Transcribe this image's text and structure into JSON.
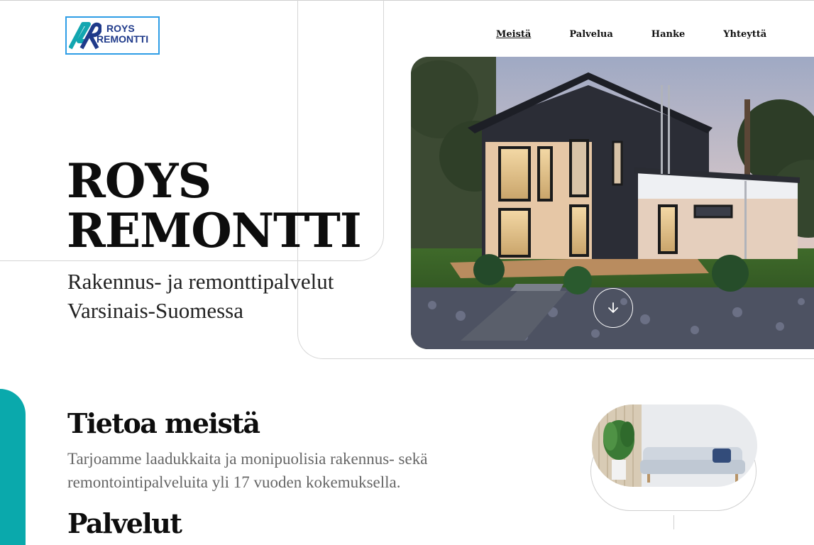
{
  "brand": {
    "logo_line1": "ROYS",
    "logo_line2": "REMONTTI",
    "colors": {
      "teal": "#0aa9ac",
      "navy": "#1f3a8a",
      "logo_border": "#2e9de6"
    }
  },
  "nav": {
    "items": [
      {
        "label": "Meistä",
        "active": true
      },
      {
        "label": "Palvelua",
        "active": false
      },
      {
        "label": "Hanke",
        "active": false
      },
      {
        "label": "Yhteyttä",
        "active": false
      }
    ]
  },
  "hero": {
    "title_line1": "ROYS",
    "title_line2": "REMONTTI",
    "subtitle_line1": "Rakennus- ja remonttipalvelut",
    "subtitle_line2": "Varsinais-Suomessa",
    "image": "house-photo",
    "scroll_icon": "arrow-down-icon"
  },
  "about": {
    "title": "Tietoa meistä",
    "text_line1": "Tarjoamme laadukkaita ja monipuolisia rakennus- sekä",
    "text_line2": "remontointipalveluita yli 17 vuoden kokemuksella.",
    "image": "sofa-photo"
  },
  "services": {
    "title": "Palvelut"
  }
}
